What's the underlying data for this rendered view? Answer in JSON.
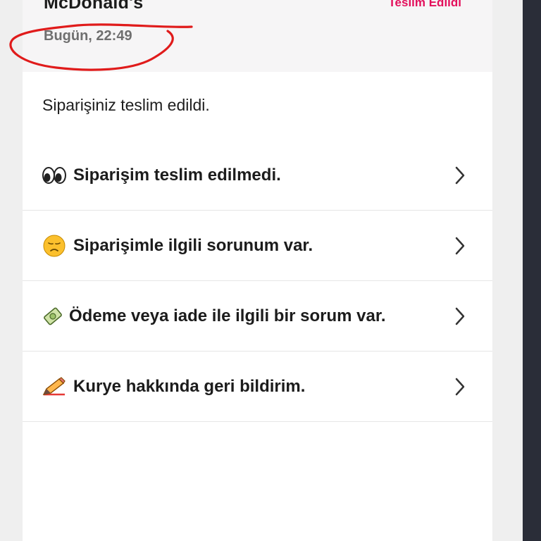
{
  "header": {
    "restaurant_name": "McDonald's",
    "status": "Teslim Edildi",
    "time": "Bugün, 22:49"
  },
  "message": "Siparişiniz teslim edildi.",
  "options": [
    {
      "icon": "eyes-icon",
      "label": "Siparişim teslim edilmedi."
    },
    {
      "icon": "disappointed-face-icon",
      "label": "Siparişimle ilgili sorunum var."
    },
    {
      "icon": "money-icon",
      "label": "Ödeme veya iade ile ilgili bir sorum var."
    },
    {
      "icon": "pencil-icon",
      "label": "Kurye hakkında geri bildirim."
    }
  ],
  "colors": {
    "accent": "#e3105c",
    "annotation": "#e01b1b"
  }
}
